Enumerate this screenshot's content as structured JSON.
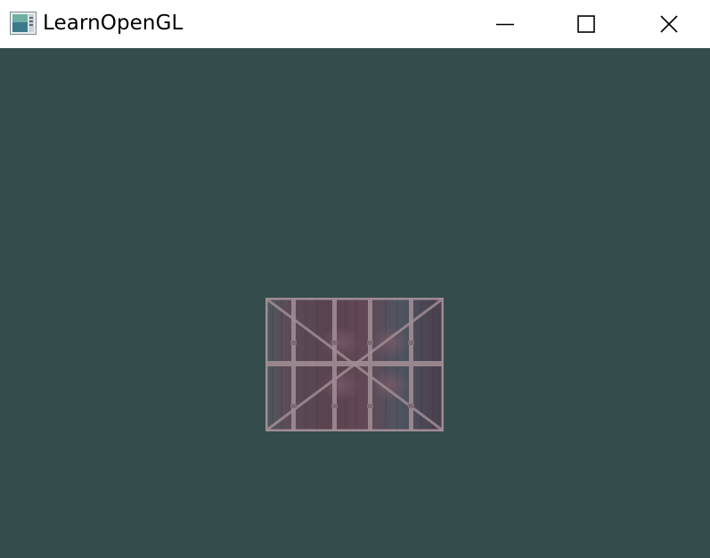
{
  "window": {
    "title": "LearnOpenGL",
    "clear_color": "#344c4c"
  },
  "icons": {
    "app": "learnopengl-app-icon",
    "minimize": "minimize-icon",
    "maximize": "maximize-icon",
    "close": "close-icon"
  },
  "scene": {
    "object": "textured-quad",
    "texture": "wooden-container-with-awesome-face"
  }
}
